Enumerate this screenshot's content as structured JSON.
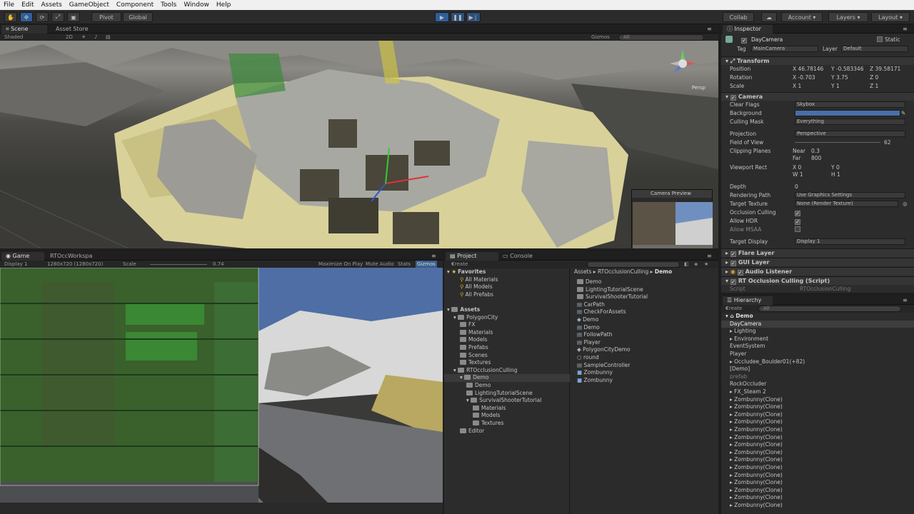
{
  "menu": [
    "File",
    "Edit",
    "Assets",
    "GameObject",
    "Component",
    "Tools",
    "Window",
    "Help"
  ],
  "toolbar": {
    "pivot": "Pivot",
    "global": "Global",
    "collab": "Collab",
    "account": "Account",
    "layers": "Layers",
    "layout": "Layout"
  },
  "scene": {
    "tab": "Scene",
    "tab2": "Asset Store",
    "shaded": "Shaded",
    "mode2d": "2D",
    "gizmos": "Gizmos",
    "search": "All",
    "persp": "Persp",
    "preview_title": "Camera Preview"
  },
  "game": {
    "tab": "Game",
    "tab2": "RTOccWorkspa",
    "display": "Display 1",
    "resolution": "1280x720 (1280x720)",
    "scale_label": "Scale",
    "scale_value": "0.74",
    "maximize": "Maximize On Play",
    "mute": "Mute Audio",
    "stats": "Stats",
    "gizmos": "Gizmos"
  },
  "project": {
    "tab": "Project",
    "tab2": "Console",
    "create": "Create",
    "breadcrumb": [
      "Assets",
      "RTOcclusionCulling",
      "Demo"
    ],
    "favorites": {
      "label": "Favorites",
      "items": [
        "All Materials",
        "All Models",
        "All Prefabs"
      ]
    },
    "tree": [
      {
        "label": "Assets",
        "indent": 0
      },
      {
        "label": "PolygonCity",
        "indent": 1
      },
      {
        "label": "FX",
        "indent": 2
      },
      {
        "label": "Materials",
        "indent": 2
      },
      {
        "label": "Models",
        "indent": 2
      },
      {
        "label": "Prefabs",
        "indent": 2
      },
      {
        "label": "Scenes",
        "indent": 2
      },
      {
        "label": "Textures",
        "indent": 2
      },
      {
        "label": "RTOcclusionCulling",
        "indent": 1
      },
      {
        "label": "Demo",
        "indent": 2
      },
      {
        "label": "Demo",
        "indent": 3
      },
      {
        "label": "LightingTutorialScene",
        "indent": 3
      },
      {
        "label": "SurvivalShooterTutorial",
        "indent": 3
      },
      {
        "label": "Materials",
        "indent": 4
      },
      {
        "label": "Models",
        "indent": 4
      },
      {
        "label": "Textures",
        "indent": 4
      },
      {
        "label": "Editor",
        "indent": 2
      }
    ],
    "files": [
      "Demo",
      "LightingTutorialScene",
      "SurvivalShooterTutorial",
      "CarPath",
      "CheckForAssets",
      "Demo",
      "Demo",
      "FollowPath",
      "Player",
      "PolygonCityDemo",
      "round",
      "SampleController",
      "Zombunny",
      "Zombunny"
    ]
  },
  "inspector": {
    "tab": "Inspector",
    "object_name": "DayCamera",
    "static": "Static",
    "tag_label": "Tag",
    "tag": "MainCamera",
    "layer_label": "Layer",
    "layer": "Default",
    "transform": "Transform",
    "position_label": "Position",
    "position": {
      "x": "46.78146",
      "y": "-0.583346",
      "z": "39.58171"
    },
    "rotation_label": "Rotation",
    "rotation": {
      "x": "-0.703",
      "y": "3.75",
      "z": "0"
    },
    "scale_label": "Scale",
    "scale": {
      "x": "1",
      "y": "1",
      "z": "1"
    },
    "camera": "Camera",
    "clear_flags_label": "Clear Flags",
    "clear_flags": "Skybox",
    "background_label": "Background",
    "background_color": "#4a6ea8",
    "culling_mask_label": "Culling Mask",
    "culling_mask": "Everything",
    "projection_label": "Projection",
    "projection": "Perspective",
    "fov_label": "Field of View",
    "fov": "62",
    "clipping_label": "Clipping Planes",
    "near_label": "Near",
    "near": "0.3",
    "far_label": "Far",
    "far": "800",
    "viewport_label": "Viewport Rect",
    "vp": {
      "x": "0",
      "y": "0",
      "w": "1",
      "h": "1"
    },
    "depth_label": "Depth",
    "depth": "0",
    "rendering_path_label": "Rendering Path",
    "rendering_path": "Use Graphics Settings",
    "target_texture_label": "Target Texture",
    "target_texture": "None (Render Texture)",
    "occlusion_label": "Occlusion Culling",
    "hdr_label": "Allow HDR",
    "msaa_label": "Allow MSAA",
    "target_display_label": "Target Display",
    "target_display": "Display 1",
    "components": [
      "Flare Layer",
      "GUI Layer",
      "Audio Listener",
      "RT Occlusion Culling (Script)"
    ],
    "script_label": "Script",
    "script_value": "RTOcclusionCulling"
  },
  "hierarchy": {
    "tab": "Hierarchy",
    "create": "Create",
    "search": "All",
    "scene": "Demo",
    "items": [
      "DayCamera",
      "Lighting",
      "Environment",
      "EventSystem",
      "Player",
      "Occludee_Boulder01(+82)",
      "[Demo]",
      "prefab",
      "RockOccluder",
      "FX_Steam 2",
      "Zombunny(Clone)",
      "Zombunny(Clone)",
      "Zombunny(Clone)",
      "Zombunny(Clone)",
      "Zombunny(Clone)",
      "Zombunny(Clone)",
      "Zombunny(Clone)",
      "Zombunny(Clone)",
      "Zombunny(Clone)",
      "Zombunny(Clone)",
      "Zombunny(Clone)",
      "Zombunny(Clone)",
      "Zombunny(Clone)",
      "Zombunny(Clone)",
      "Zombunny(Clone)"
    ]
  }
}
